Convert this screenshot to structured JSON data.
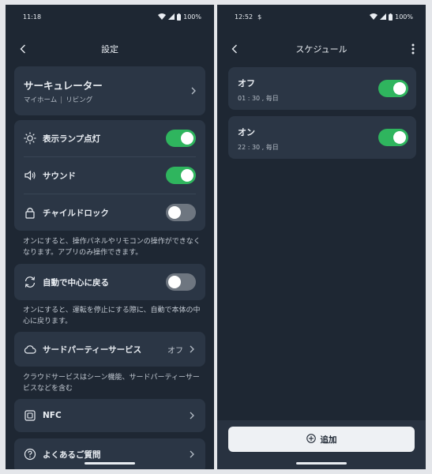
{
  "left": {
    "status": {
      "time": "11:18",
      "battery": "100%"
    },
    "title": "設定",
    "device": {
      "name": "サーキュレーター",
      "home": "マイホーム",
      "room": "リビング"
    },
    "toggles": [
      {
        "label": "表示ランプ点灯",
        "icon": "sun-icon",
        "state": "on"
      },
      {
        "label": "サウンド",
        "icon": "speaker-icon",
        "state": "on"
      },
      {
        "label": "チャイルドロック",
        "icon": "lock-icon",
        "state": "off"
      }
    ],
    "child_lock_note": "オンにすると、操作パネルやリモコンの操作ができなくなります。アプリのみ操作できます。",
    "auto_center": {
      "label": "自動で中心に戻る",
      "state": "off"
    },
    "auto_center_note": "オンにすると、運転を停止にする際に、自動で本体の中心に戻ります。",
    "third_party": {
      "label": "サードパーティーサービス",
      "value": "オフ"
    },
    "third_party_note": "クラウドサービスはシーン機能、サードパーティーサービスなどを含む",
    "nfc": {
      "label": "NFC"
    },
    "faq": {
      "label": "よくあるご質問"
    }
  },
  "right": {
    "status": {
      "time": "12:52",
      "extra": "$",
      "battery": "100%"
    },
    "title": "スケジュール",
    "schedules": [
      {
        "name": "オフ",
        "detail": "01 : 30 , 毎日",
        "state": "on"
      },
      {
        "name": "オン",
        "detail": "22 : 30 , 毎日",
        "state": "on"
      }
    ],
    "add_label": "追加"
  },
  "colors": {
    "background": "#1e2733",
    "card": "#2b3645",
    "toggle_on": "#2fb55e",
    "toggle_off": "#6e7680"
  }
}
